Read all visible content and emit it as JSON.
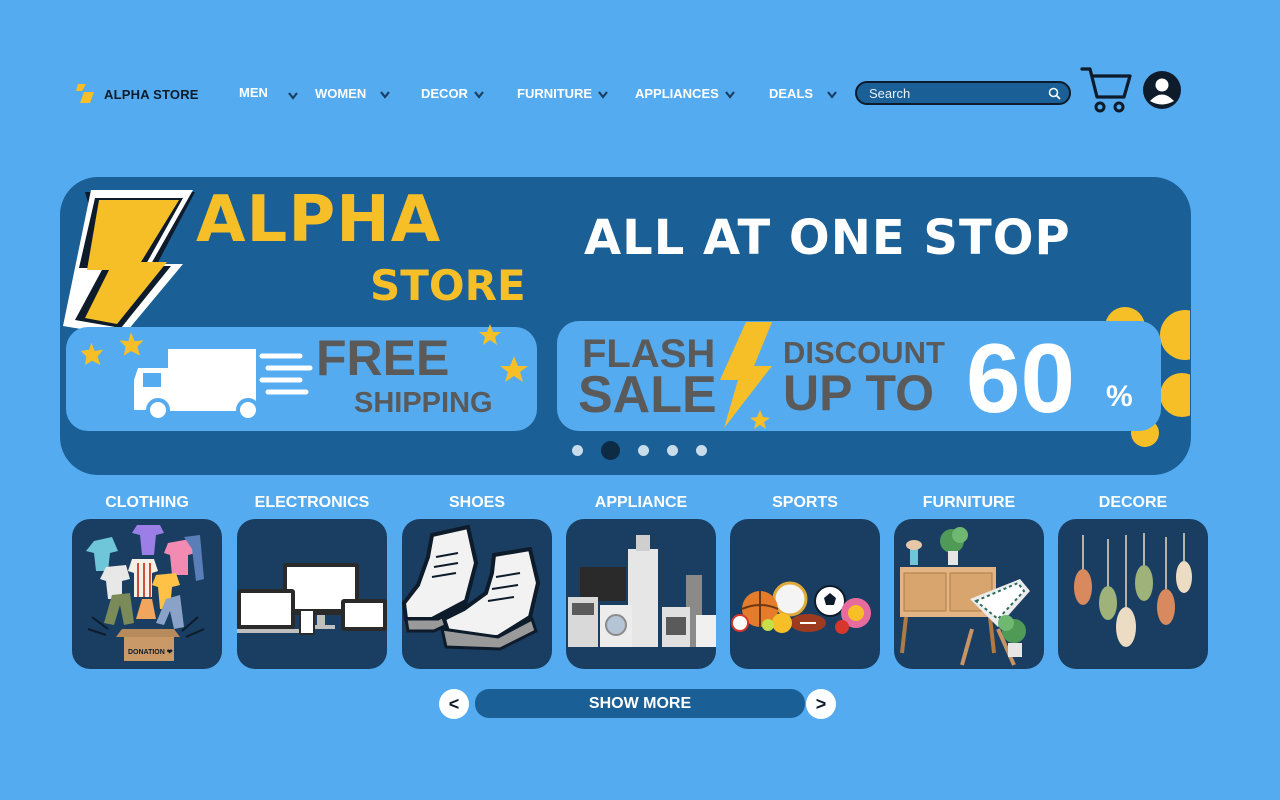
{
  "header": {
    "logo_text": "ALPHA STORE",
    "nav": [
      "MEN",
      "WOMEN",
      "DECOR",
      "FURNITURE",
      "APPLIANCES",
      "DEALS"
    ],
    "search_placeholder": "Search"
  },
  "banner": {
    "brand_line1": "ALPHA",
    "brand_line2": "STORE",
    "slogan": "ALL AT ONE STOP",
    "free_title": "FREE",
    "free_sub": "SHIPPING",
    "flash": "FLASH",
    "sale": "SALE",
    "discount": "DISCOUNT",
    "up_to": "UP TO",
    "percent_value": "60",
    "percent_sign": "%",
    "slides_total": 5,
    "active_slide": 2
  },
  "categories": [
    "CLOTHING",
    "ELECTRONICS",
    "SHOES",
    "APPLIANCE",
    "SPORTS",
    "FURNITURE",
    "DECORE"
  ],
  "clothing_box_label": "DONATION ❤",
  "pager": {
    "prev": "<",
    "next": ">",
    "show_more": "SHOW MORE"
  },
  "colors": {
    "background": "#55abef",
    "banner": "#1a5f95",
    "accent_yellow": "#f6bf27",
    "card": "#1a3e62"
  }
}
